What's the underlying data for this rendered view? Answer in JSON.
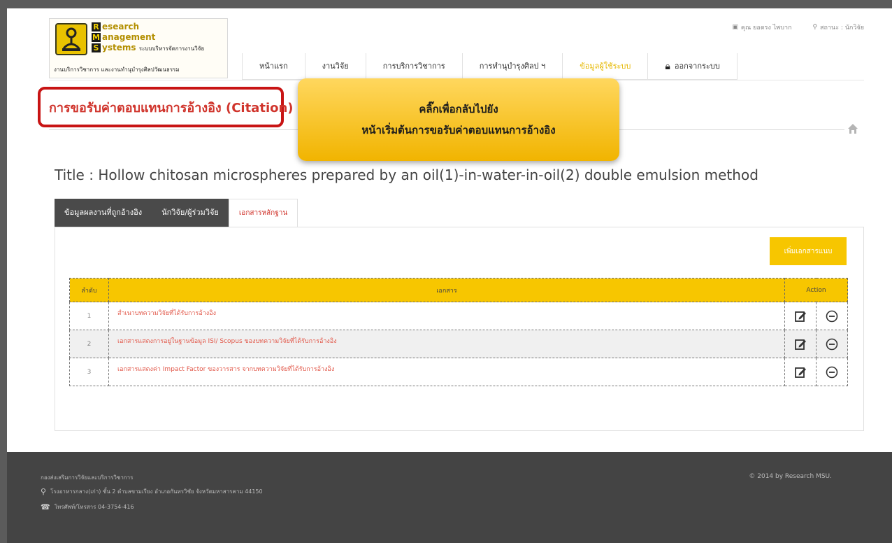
{
  "logo": {
    "line1": "esearch",
    "line2": "anagement",
    "line3": "ystems",
    "line3_suffix": "ระบบบริหารจัดการงานวิจัย",
    "cap1": "R",
    "cap2": "M",
    "cap3": "S",
    "sub": "งานบริการวิชาการ และงานทำนุบำรุงศิลปวัฒนธรรม"
  },
  "topbar": {
    "user": "คุณ ยอดรง ไพบาก",
    "status": "สถานะ : นักวิจัย"
  },
  "nav": {
    "items": [
      "หน้าแรก",
      "งานวิจัย",
      "การบริการวิชาการ",
      "การทำนุบำรุงศิลป ฯ",
      "ข้อมูลผู้ใช้ระบบ",
      "ออกจากระบบ"
    ]
  },
  "page_title": "การขอรับค่าตอบแทนการอ้างอิง (Citation)",
  "callout": {
    "line1": "คลิ๊กเพื่อกลับไปยัง",
    "line2": "หน้าเริ่มต้นการขอรับค่าตอบแทนการอ้างอิง"
  },
  "doc_title": "Title : Hollow chitosan microspheres prepared by an oil(1)-in-water-in-oil(2) double emulsion method",
  "tabs": [
    "ข้อมูลผลงานที่ถูกอ้างอิง",
    "นักวิจัย/ผู้ร่วมวิจัย",
    "เอกสารหลักฐาน"
  ],
  "add_button": "เพิ่มเอกสารแนบ",
  "table": {
    "headers": [
      "ลำดับ",
      "เอกสาร",
      "Action"
    ],
    "rows": [
      {
        "no": "1",
        "doc": "สำเนาบทความวิจัยที่ได้รับการอ้างอิง"
      },
      {
        "no": "2",
        "doc": "เอกสารแสดงการอยู่ในฐานข้อมูล ISI/ Scopus ของบทความวิจัยที่ได้รับการอ้างอิง"
      },
      {
        "no": "3",
        "doc": "เอกสารแสดงค่า Impact Factor ของวารสาร จากบทความวิจัยที่ได้รับการอ้างอิง"
      }
    ]
  },
  "footer": {
    "org": "กองส่งเสริมการวิจัยและบริการวิชาการ",
    "address": "โรงอาหารกลาง(เก่า) ชั้น 2 ตำบลขามเรียง อำเภอกันทรวิชัย จังหวัดมหาสารคาม 44150",
    "tel": "โทรศัพท์/โทรสาร 04-3754-416",
    "copyright": "© 2014 by Research MSU."
  },
  "colors": {
    "accent": "#f7c600",
    "title_red": "#d0342c",
    "tab_dark": "#4a4a4a",
    "footer": "#444444"
  }
}
